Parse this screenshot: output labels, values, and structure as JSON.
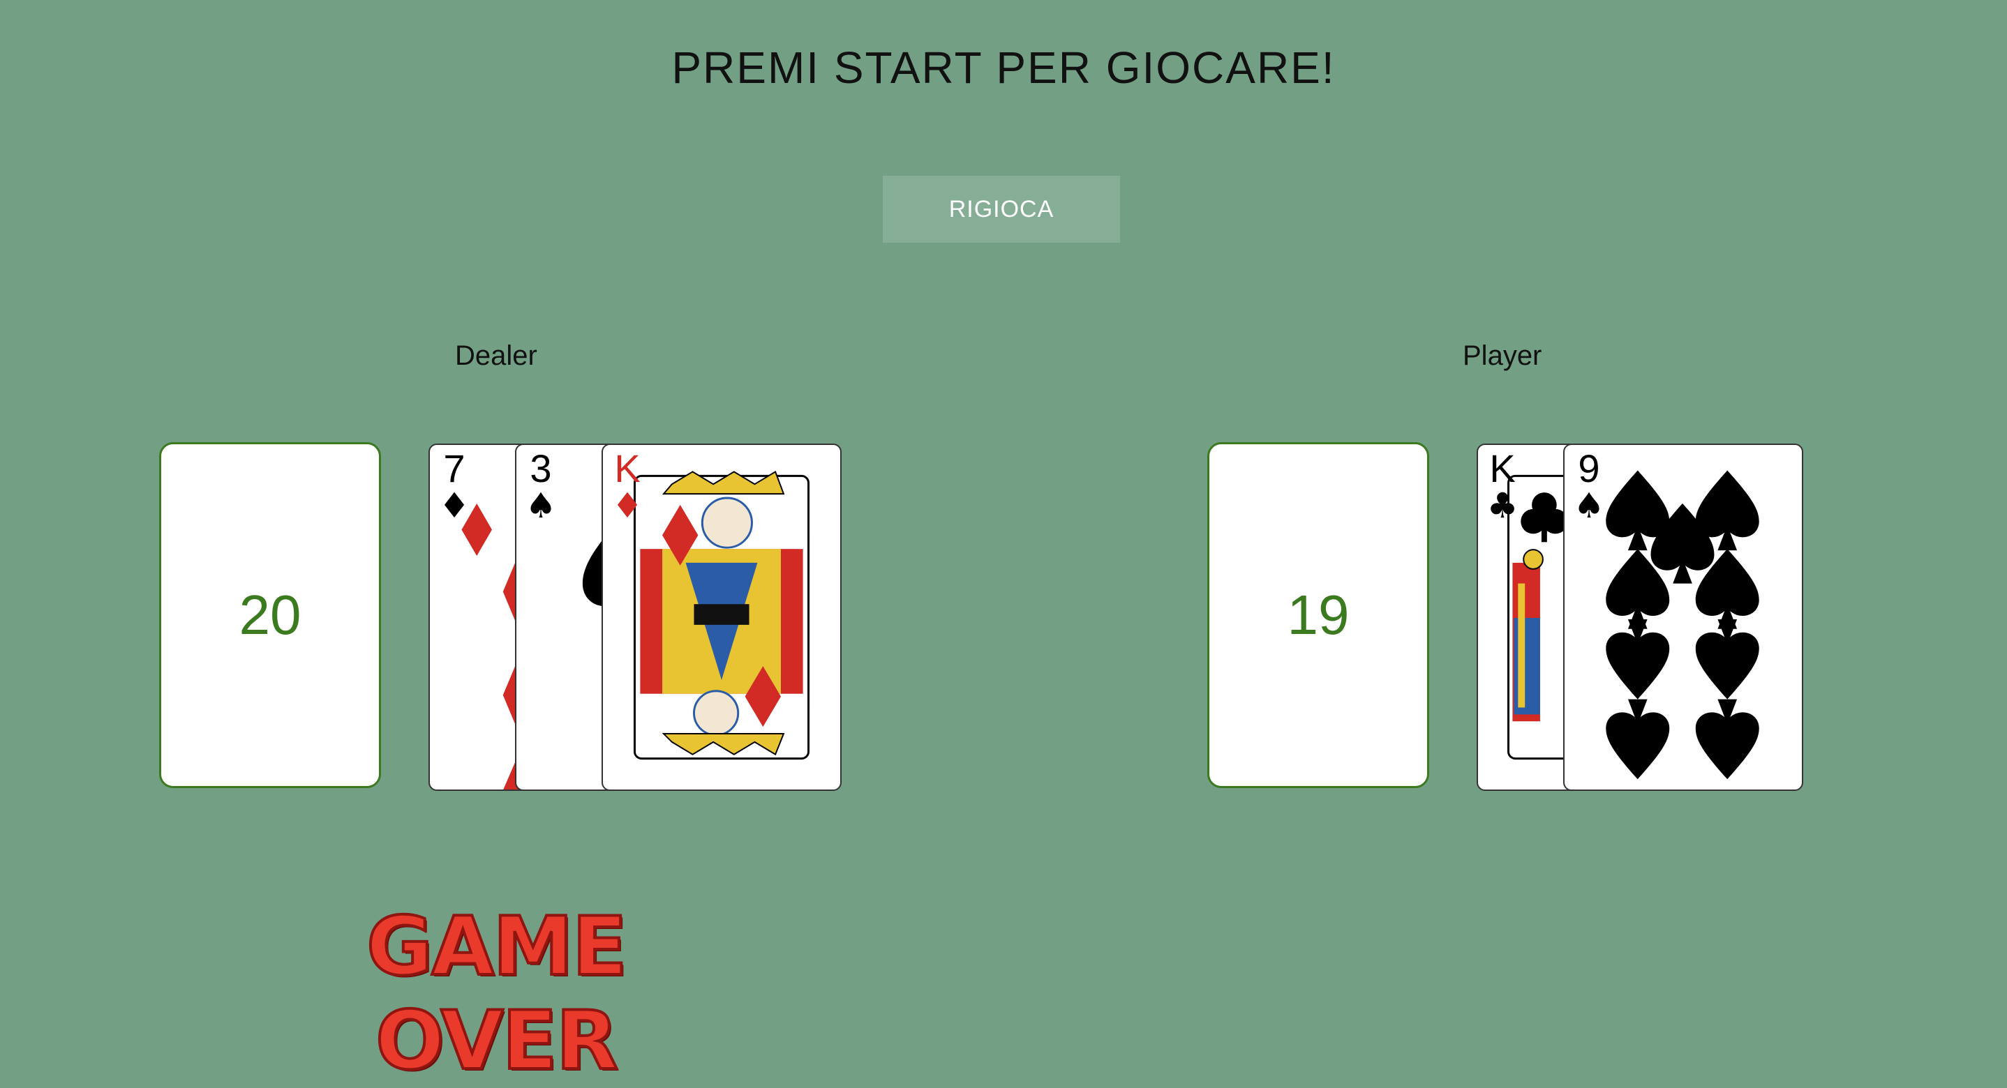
{
  "header": {
    "title": "PREMI START PER GIOCARE!"
  },
  "controls": {
    "replay_label": "RIGIOCA"
  },
  "dealer": {
    "label": "Dealer",
    "score": "20",
    "cards": [
      {
        "rank": "7",
        "suit": "♦",
        "color": "#d22a24"
      },
      {
        "rank": "3",
        "suit": "♠",
        "color": "#000000"
      },
      {
        "rank": "K",
        "suit": "♦",
        "color": "#d22a24"
      }
    ]
  },
  "player": {
    "label": "Player",
    "score": "19",
    "cards": [
      {
        "rank": "K",
        "suit": "♣",
        "color": "#000000"
      },
      {
        "rank": "9",
        "suit": "♠",
        "color": "#000000"
      }
    ]
  },
  "status": {
    "game_over": "GAME OVER"
  },
  "colors": {
    "table_green": "#73a085",
    "score_green": "#3c7a1f",
    "card_red": "#d22a24",
    "game_over_red": "#ea3a2c"
  }
}
